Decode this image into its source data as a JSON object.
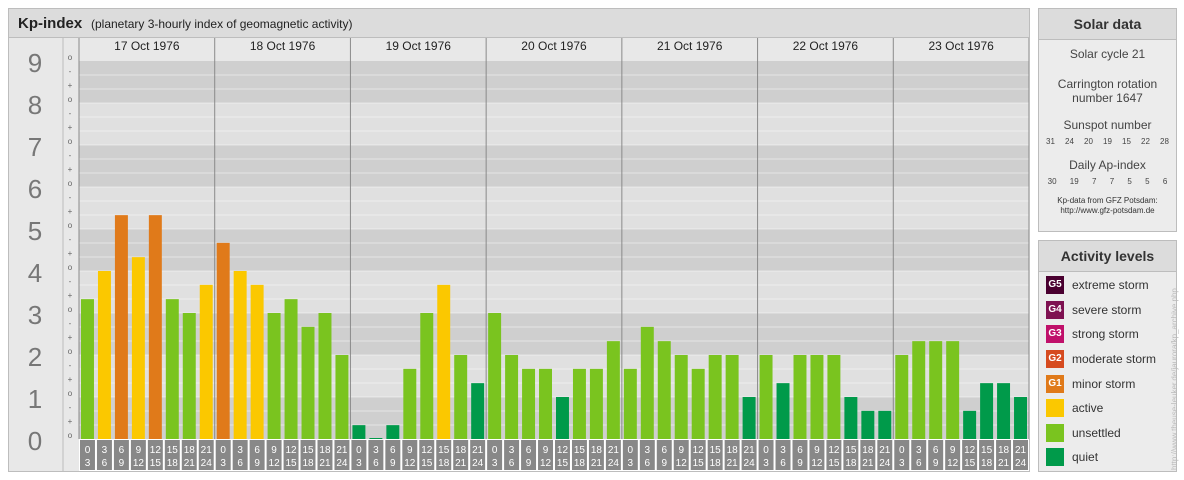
{
  "header": {
    "title": "Kp-index",
    "subtitle": "(planetary 3-hourly index of geomagnetic activity)"
  },
  "chart_data": {
    "type": "bar",
    "y_axis": {
      "min": 0,
      "max": 9,
      "labels": [
        "0",
        "1",
        "2",
        "3",
        "4",
        "5",
        "6",
        "7",
        "8",
        "9"
      ],
      "minor_marks": [
        "o",
        "+",
        "-"
      ]
    },
    "days": [
      "17 Oct 1976",
      "18 Oct 1976",
      "19 Oct 1976",
      "20 Oct 1976",
      "21 Oct 1976",
      "22 Oct 1976",
      "23 Oct 1976"
    ],
    "slot_labels": [
      [
        "0",
        "3"
      ],
      [
        "3",
        "6"
      ],
      [
        "6",
        "9"
      ],
      [
        "9",
        "12"
      ],
      [
        "12",
        "15"
      ],
      [
        "15",
        "18"
      ],
      [
        "18",
        "21"
      ],
      [
        "21",
        "24"
      ]
    ],
    "kp_values": [
      [
        3.33,
        4.0,
        5.33,
        4.33,
        5.33,
        3.33,
        3.0,
        3.67
      ],
      [
        4.67,
        4.0,
        3.67,
        3.0,
        3.33,
        2.67,
        3.0,
        2.0
      ],
      [
        0.33,
        0.0,
        0.33,
        1.67,
        3.0,
        3.67,
        2.0,
        1.33
      ],
      [
        3.0,
        2.0,
        1.67,
        1.67,
        1.0,
        1.67,
        1.67,
        2.33
      ],
      [
        1.67,
        2.67,
        2.33,
        2.0,
        1.67,
        2.0,
        2.0,
        1.0
      ],
      [
        2.0,
        1.33,
        2.0,
        2.0,
        2.0,
        1.0,
        0.67,
        0.67
      ],
      [
        2.0,
        2.33,
        2.33,
        2.33,
        0.67,
        1.33,
        1.33,
        1.0
      ]
    ],
    "colors": {
      "quiet": "#009a4a",
      "unsettled": "#7ac41f",
      "active": "#fbc800",
      "minor": "#e07a1a",
      "moderate": "#d64a1e",
      "strong": "#c0106a",
      "severe": "#7e1151",
      "extreme": "#4a0030"
    },
    "grid": true
  },
  "solar": {
    "title": "Solar data",
    "cycle": "Solar cycle 21",
    "carrington_line1": "Carrington rotation",
    "carrington_line2": "number 1647",
    "sunspot_title": "Sunspot number",
    "sunspot_values": [
      "31",
      "24",
      "20",
      "19",
      "15",
      "22",
      "28"
    ],
    "ap_title": "Daily Ap-index",
    "ap_values": [
      "30",
      "19",
      "7",
      "7",
      "5",
      "5",
      "6"
    ],
    "credit_line1": "Kp-data from  GFZ Potsdam:",
    "credit_line2": "http://www.gfz-potsdam.de"
  },
  "activity": {
    "title": "Activity levels",
    "items": [
      {
        "badge": "G5",
        "label": "extreme storm",
        "color": "#4a0030"
      },
      {
        "badge": "G4",
        "label": "severe storm",
        "color": "#7e1151"
      },
      {
        "badge": "G3",
        "label": "strong storm",
        "color": "#c0106a"
      },
      {
        "badge": "G2",
        "label": "moderate storm",
        "color": "#d64a1e"
      },
      {
        "badge": "G1",
        "label": "minor storm",
        "color": "#e07a1a"
      },
      {
        "badge": "",
        "label": "active",
        "color": "#fbc800"
      },
      {
        "badge": "",
        "label": "unsettled",
        "color": "#7ac41f"
      },
      {
        "badge": "",
        "label": "quiet",
        "color": "#009a4a"
      }
    ]
  },
  "watermark": "http://www.theuse-leuker.de/jaurora/kp_archive.php"
}
